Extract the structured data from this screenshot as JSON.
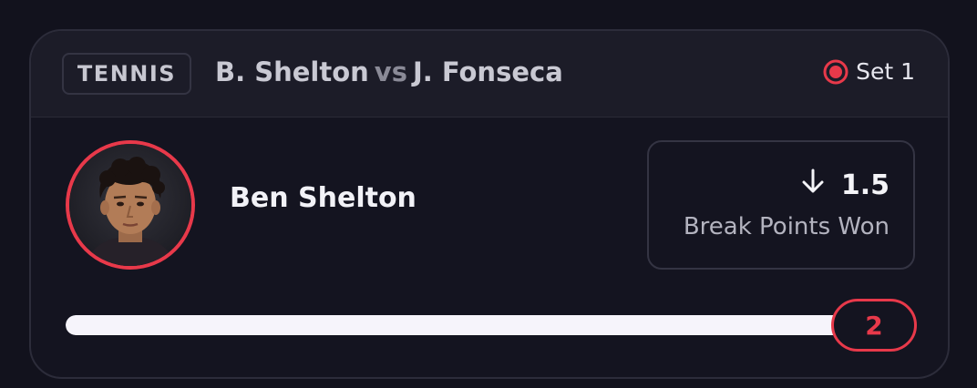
{
  "header": {
    "sport": "TENNIS",
    "player_a": "B. Shelton",
    "vs": "vs",
    "player_b": "J. Fonseca",
    "status": "Set 1"
  },
  "player": {
    "name": "Ben Shelton"
  },
  "stat": {
    "direction": "down",
    "line": "1.5",
    "label": "Break Points Won"
  },
  "progress": {
    "current": "2",
    "fill_fraction": 1.0
  },
  "colors": {
    "accent_red": "#e8394a",
    "bar_fill": "#f6f4fb",
    "background": "#12121d"
  },
  "icons": {
    "live": "live-indicator-icon",
    "direction": "arrow-down-icon"
  }
}
